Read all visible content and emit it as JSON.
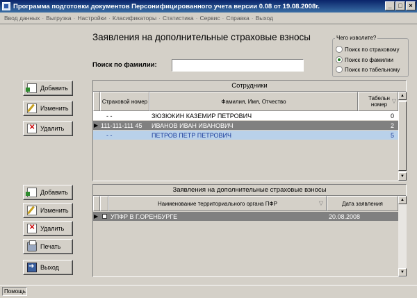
{
  "window": {
    "title": "Программа подготовки документов Персонифицированного учета версии 0.08 от 19.08.2008г.",
    "minimize": "_",
    "maximize": "□",
    "close": "×"
  },
  "menu": [
    "Ввод данных",
    "Выгрузка",
    "Настройки",
    "Класификаторы",
    "Статистика",
    "Сервис",
    "Справка",
    "Выход"
  ],
  "menu_separator": "·",
  "heading": "Заявления на дополнительные страховые взносы",
  "search": {
    "label": "Поиск по фамилии:",
    "value": ""
  },
  "search_mode": {
    "title": "Чего изволите?",
    "options": [
      "Поиск по страховому",
      "Поиск по фамилии",
      "Поиск по табельному"
    ],
    "selected_index": 1
  },
  "buttons_top": {
    "add": "Добавить",
    "edit": "Изменить",
    "delete": "Удалить"
  },
  "buttons_bottom": {
    "add": "Добавить",
    "edit": "Изменить",
    "delete": "Удалить",
    "print": "Печать",
    "exit": "Выход"
  },
  "employees": {
    "title": "Сотрудники",
    "columns": [
      "Страховой номер",
      "Фамилия, Имя, Отчество",
      "Табельн номер"
    ],
    "rows": [
      {
        "insurance": "-    -",
        "name": "ЗЮЗЮКИН КАЗЕМИР ПЕТРОВИЧ",
        "tab": "0"
      },
      {
        "insurance": "111-111-111 45",
        "name": "ИВАНОВ ИВАН ИВАНОВИЧ",
        "tab": "2"
      },
      {
        "insurance": "-    -",
        "name": "ПЕТРОВ ПЕТР ПЕТРОВИЧ",
        "tab": "5"
      }
    ],
    "current_row_marker": "▶"
  },
  "applications": {
    "title": "Заявления на дополнительные страховые взносы",
    "columns": [
      "Наименование территориального органа ПФР",
      "Дата заявления"
    ],
    "rows": [
      {
        "org": "УПФР В Г.ОРЕНБУРГЕ",
        "date": "20.08.2008"
      }
    ],
    "current_row_marker": "▶"
  },
  "sort_indicator": "▽",
  "status": "Помощь",
  "colors": {
    "selected_row": "#808080",
    "highlight_row": "#b9d1ea",
    "title_blue": "#0a246a"
  }
}
